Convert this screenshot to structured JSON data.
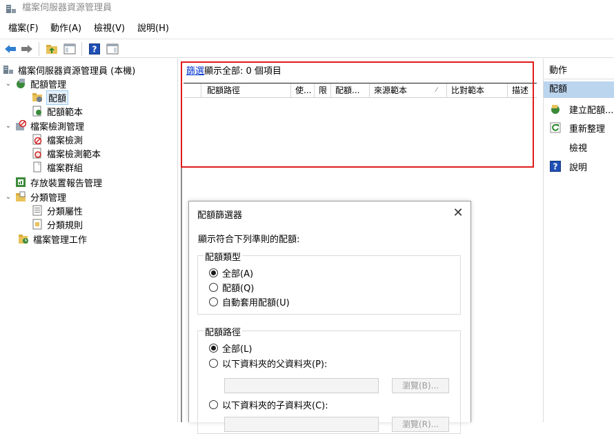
{
  "window": {
    "title": "檔案伺服器資源管理員"
  },
  "menu": [
    "檔案(F)",
    "動作(A)",
    "檢視(V)",
    "說明(H)"
  ],
  "toolbar": {
    "icons": [
      "back-arrow-icon",
      "forward-arrow-icon",
      "up-folder-icon",
      "show-hide-tree-icon",
      "help-icon",
      "action-pane-icon"
    ]
  },
  "tree": {
    "root": "檔案伺服器資源管理員 (本機)",
    "quota_management": "配額管理",
    "quotas": "配額",
    "quota_templates": "配額範本",
    "file_screening": "檔案檢測管理",
    "file_screens": "檔案檢測",
    "file_screen_templates": "檔案檢測範本",
    "file_groups": "檔案群組",
    "storage_reports": "存放裝置報告管理",
    "classification": "分類管理",
    "classification_properties": "分類屬性",
    "classification_rules": "分類規則",
    "file_management_tasks": "檔案管理工作"
  },
  "middle": {
    "filter_link": "篩選",
    "filter_text": "顯示全部: 0 個項目",
    "columns": [
      "配額路徑",
      "使...",
      "限",
      "配額...",
      "來源範本",
      "比對範本",
      "描述"
    ]
  },
  "dialog": {
    "title": "配額篩選器",
    "description": "顯示符合下列準則的配額:",
    "quota_type": {
      "label": "配額類型",
      "options": [
        "全部(A)",
        "配額(Q)",
        "自動套用配額(U)"
      ],
      "selected": "全部(A)"
    },
    "quota_path": {
      "label": "配額路徑",
      "options": [
        "全部(L)",
        "以下資料夾的父資料夾(P):",
        "以下資料夾的子資料夾(C):"
      ],
      "selected": "全部(L)",
      "browse_label_1": "瀏覽(B)...",
      "browse_label_2": "瀏覽(R)..."
    }
  },
  "actions": {
    "header": "動作",
    "section": "配額",
    "items": [
      "建立配額...",
      "重新整理",
      "檢視",
      "說明"
    ]
  },
  "colors": {
    "highlight_border": "#e01a1a",
    "selected_section_bg": "#bcd5ee",
    "link": "#0033cc"
  }
}
